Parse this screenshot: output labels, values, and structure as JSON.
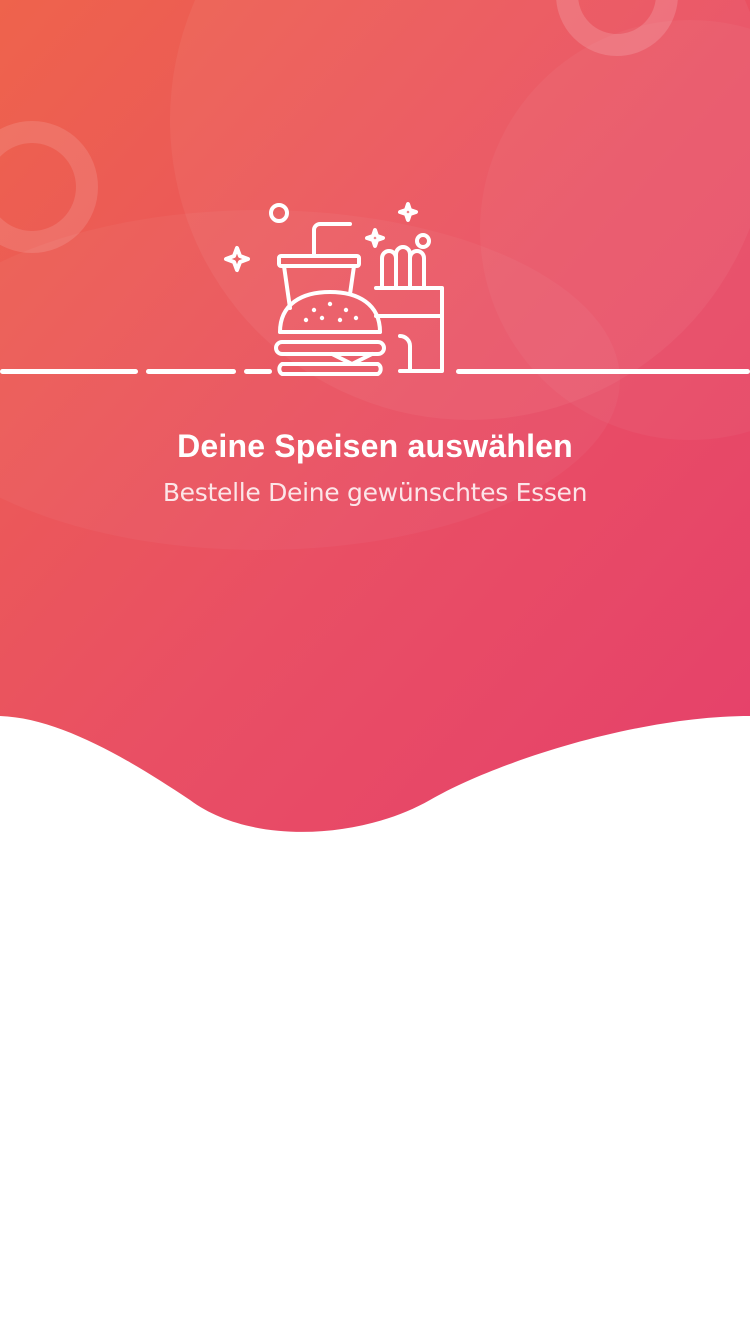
{
  "onboarding": {
    "title": "Deine Speisen auswählen",
    "subtitle": "Bestelle Deine gewünschtes Essen"
  },
  "colors": {
    "gradient_top": "#ec5c4f",
    "gradient_bottom": "#e6406a",
    "background": "#ffffff",
    "text": "#ffffff"
  },
  "icons": [
    "food-combo-icon",
    "sparkle-icon",
    "ring-icon"
  ]
}
